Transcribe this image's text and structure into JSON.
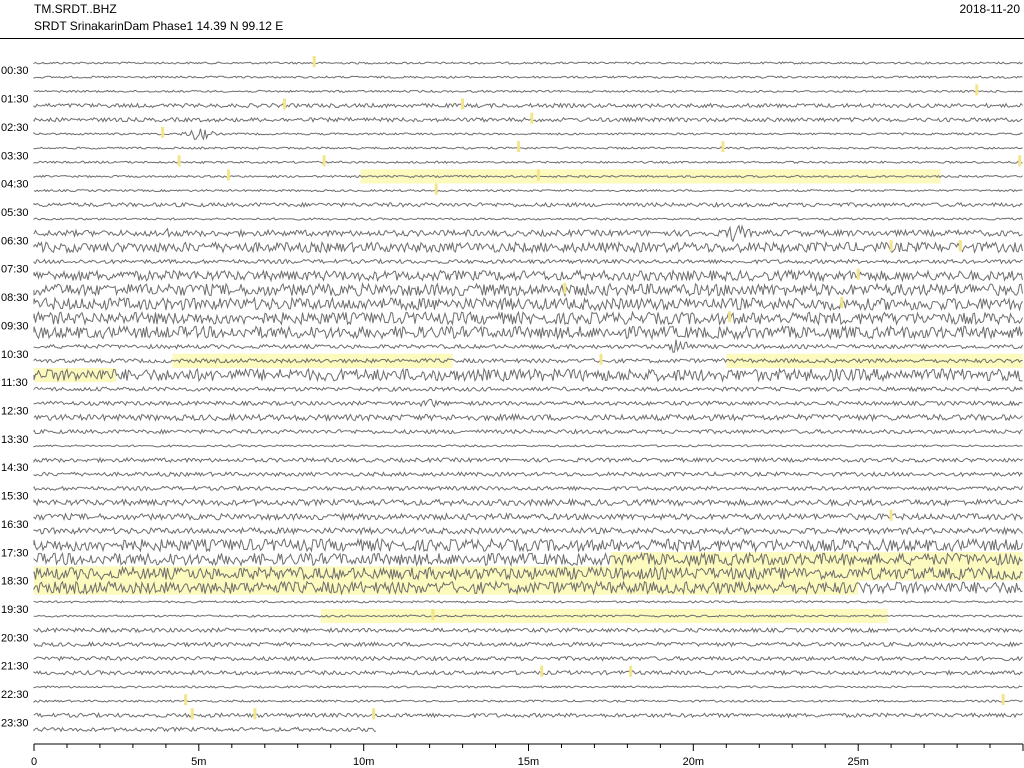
{
  "header": {
    "station_id": "TM.SRDT..BHZ",
    "station_location": "SRDT SrinakarinDam Phase1  14.39 N 99.12 E",
    "date": "2018-11-20"
  },
  "colors": {
    "trace": "#6e6e6e",
    "event_highlight": "#fdfabe",
    "event_marker": "#f2e58a",
    "axis": "#000000"
  },
  "chart_data": {
    "type": "line",
    "subtype": "helicorder",
    "xlabel": "",
    "ylabel": "",
    "x_unit_minutes_per_row": 30,
    "xlim": [
      0,
      30
    ],
    "x_ticks": [
      {
        "value": 0,
        "label": "0"
      },
      {
        "value": 5,
        "label": "5m"
      },
      {
        "value": 10,
        "label": "10m"
      },
      {
        "value": 15,
        "label": "15m"
      },
      {
        "value": 20,
        "label": "20m"
      },
      {
        "value": 25,
        "label": "25m"
      }
    ],
    "y_tick_labels": [
      "00:30",
      "01:30",
      "02:30",
      "03:30",
      "04:30",
      "05:30",
      "06:30",
      "07:30",
      "08:30",
      "09:30",
      "10:30",
      "11:30",
      "12:30",
      "13:30",
      "14:30",
      "15:30",
      "16:30",
      "17:30",
      "18:30",
      "19:30",
      "20:30",
      "21:30",
      "22:30",
      "23:30"
    ],
    "row_noise_amplitude": [
      1,
      1,
      1,
      2,
      2,
      1,
      1,
      1,
      1,
      1,
      2,
      1,
      3,
      5,
      2,
      5,
      6,
      6,
      6,
      6,
      2,
      2,
      6,
      2,
      2,
      3,
      2,
      1,
      2,
      2,
      2,
      3,
      3,
      3,
      6,
      6,
      6,
      6,
      1,
      1,
      2,
      2,
      2,
      2,
      1,
      1,
      2,
      2
    ],
    "row_end_minutes": [
      30,
      30,
      30,
      30,
      30,
      30,
      30,
      30,
      30,
      30,
      30,
      30,
      30,
      30,
      30,
      30,
      30,
      30,
      30,
      30,
      30,
      30,
      30,
      30,
      30,
      30,
      30,
      30,
      30,
      30,
      30,
      30,
      30,
      30,
      30,
      30,
      30,
      30,
      30,
      30,
      30,
      30,
      30,
      30,
      30,
      30,
      30,
      10.4
    ],
    "event_highlights": [
      {
        "row": 8,
        "start_min": 9.9,
        "end_min": 27.5
      },
      {
        "row": 21,
        "start_min": 4.2,
        "end_min": 12.7
      },
      {
        "row": 21,
        "start_min": 21.0,
        "end_min": 30
      },
      {
        "row": 22,
        "start_min": 0,
        "end_min": 2.5
      },
      {
        "row": 35,
        "start_min": 17.5,
        "end_min": 30
      },
      {
        "row": 36,
        "start_min": 0,
        "end_min": 30
      },
      {
        "row": 37,
        "start_min": 0,
        "end_min": 25.0
      },
      {
        "row": 39,
        "start_min": 8.7,
        "end_min": 25.9
      }
    ],
    "event_markers": [
      {
        "row": 0,
        "min": 8.5
      },
      {
        "row": 2,
        "min": 28.6
      },
      {
        "row": 3,
        "min": 7.6
      },
      {
        "row": 3,
        "min": 13.0
      },
      {
        "row": 4,
        "min": 15.1
      },
      {
        "row": 5,
        "min": 3.9
      },
      {
        "row": 6,
        "min": 14.7
      },
      {
        "row": 6,
        "min": 20.9
      },
      {
        "row": 7,
        "min": 4.4
      },
      {
        "row": 7,
        "min": 8.8
      },
      {
        "row": 7,
        "min": 29.9
      },
      {
        "row": 8,
        "min": 15.3
      },
      {
        "row": 8,
        "min": 5.9
      },
      {
        "row": 9,
        "min": 12.2
      },
      {
        "row": 13,
        "min": 26.0
      },
      {
        "row": 13,
        "min": 28.1
      },
      {
        "row": 15,
        "min": 25.0
      },
      {
        "row": 16,
        "min": 16.1
      },
      {
        "row": 17,
        "min": 24.5
      },
      {
        "row": 18,
        "min": 21.1
      },
      {
        "row": 21,
        "min": 17.2
      },
      {
        "row": 32,
        "min": 26.0
      },
      {
        "row": 39,
        "min": 12.1
      },
      {
        "row": 43,
        "min": 15.4
      },
      {
        "row": 43,
        "min": 18.1
      },
      {
        "row": 45,
        "min": 4.6
      },
      {
        "row": 45,
        "min": 29.4
      },
      {
        "row": 46,
        "min": 4.8
      },
      {
        "row": 46,
        "min": 6.7
      },
      {
        "row": 46,
        "min": 10.3
      }
    ],
    "wave_bursts": [
      {
        "row": 5,
        "min": 5.0,
        "amp": 7
      },
      {
        "row": 12,
        "min": 4.0,
        "amp": 6
      },
      {
        "row": 12,
        "min": 21.3,
        "amp": 10
      },
      {
        "row": 19,
        "min": 21.3,
        "amp": 8
      },
      {
        "row": 20,
        "min": 19.6,
        "amp": 9
      },
      {
        "row": 24,
        "min": 12.0,
        "amp": 5
      }
    ]
  }
}
